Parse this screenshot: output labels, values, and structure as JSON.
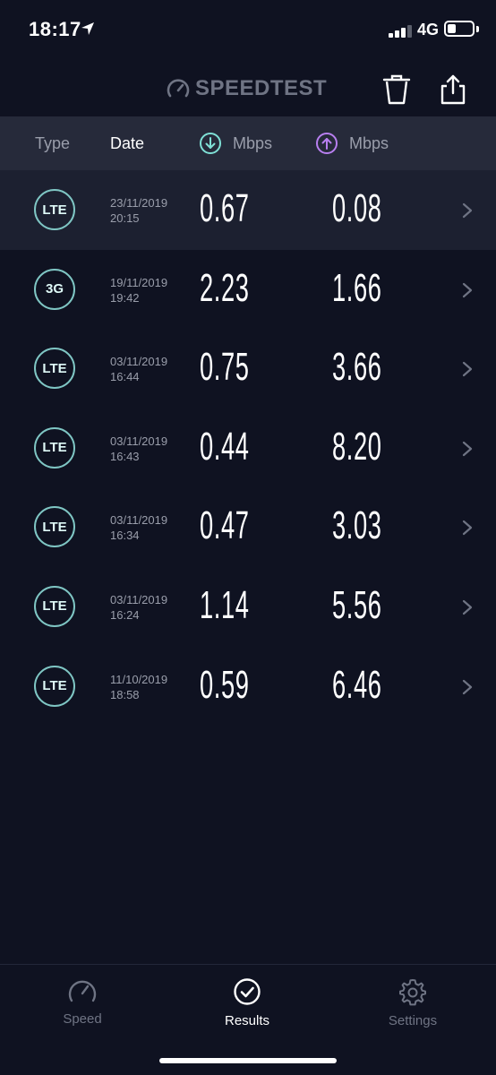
{
  "status_bar": {
    "time": "18:17",
    "network": "4G",
    "battery_level": 0.35,
    "signal_bars": 3
  },
  "header": {
    "logo_text": "SPEEDTEST",
    "delete_icon": "trash-icon",
    "share_icon": "share-icon"
  },
  "columns": {
    "type": "Type",
    "date": "Date",
    "download_unit": "Mbps",
    "upload_unit": "Mbps"
  },
  "results": [
    {
      "type": "LTE",
      "date": "23/11/2019",
      "time": "20:15",
      "download": "0.67",
      "upload": "0.08"
    },
    {
      "type": "3G",
      "date": "19/11/2019",
      "time": "19:42",
      "download": "2.23",
      "upload": "1.66"
    },
    {
      "type": "LTE",
      "date": "03/11/2019",
      "time": "16:44",
      "download": "0.75",
      "upload": "3.66"
    },
    {
      "type": "LTE",
      "date": "03/11/2019",
      "time": "16:43",
      "download": "0.44",
      "upload": "8.20"
    },
    {
      "type": "LTE",
      "date": "03/11/2019",
      "time": "16:34",
      "download": "0.47",
      "upload": "3.03"
    },
    {
      "type": "LTE",
      "date": "03/11/2019",
      "time": "16:24",
      "download": "1.14",
      "upload": "5.56"
    },
    {
      "type": "LTE",
      "date": "11/10/2019",
      "time": "18:58",
      "download": "0.59",
      "upload": "6.46"
    }
  ],
  "tabs": [
    {
      "label": "Speed",
      "icon": "speedometer-icon",
      "active": false
    },
    {
      "label": "Results",
      "icon": "check-circle-icon",
      "active": true
    },
    {
      "label": "Settings",
      "icon": "gear-icon",
      "active": false
    }
  ],
  "colors": {
    "background": "#0f1221",
    "header_band": "#262a3a",
    "download_accent": "#7fe0d6",
    "upload_accent": "#b87ff0",
    "badge_ring": "#7fc6c4"
  }
}
